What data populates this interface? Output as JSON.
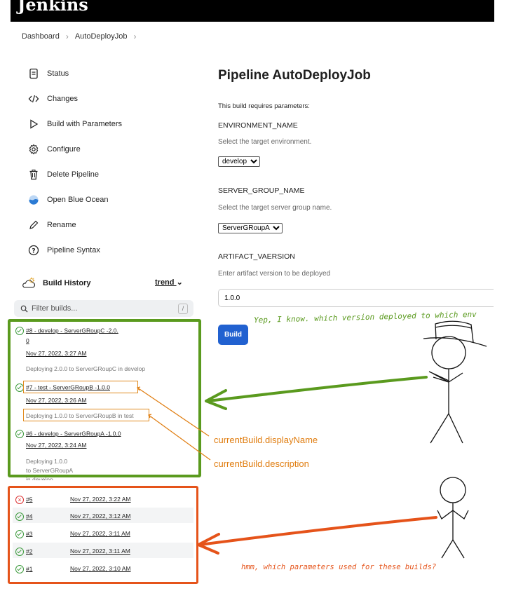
{
  "header": {
    "logo_text": "Jenkins"
  },
  "breadcrumb": {
    "items": [
      "Dashboard",
      "AutoDeployJob"
    ]
  },
  "sidebar": {
    "items": [
      {
        "label": "Status",
        "icon": "document-icon"
      },
      {
        "label": "Changes",
        "icon": "code-icon"
      },
      {
        "label": "Build with Parameters",
        "icon": "play-icon"
      },
      {
        "label": "Configure",
        "icon": "gear-icon"
      },
      {
        "label": "Delete Pipeline",
        "icon": "trash-icon"
      },
      {
        "label": "Open Blue Ocean",
        "icon": "blue-ocean-icon"
      },
      {
        "label": "Rename",
        "icon": "pencil-icon"
      },
      {
        "label": "Pipeline Syntax",
        "icon": "help-icon"
      }
    ]
  },
  "build_history": {
    "title": "Build History",
    "trend_label": "trend",
    "filter_placeholder": "Filter builds...",
    "filter_shortcut": "/",
    "detailed_builds": [
      {
        "name": "#8 - develop - ServerGRoupC -2.0.",
        "name_cont": "0",
        "date": "Nov 27, 2022, 3:27 AM",
        "desc": "Deploying 2.0.0 to ServerGRoupC in develop",
        "status": "success"
      },
      {
        "name": "#7 - test - ServerGRoupB -1.0.0",
        "date": "Nov 27, 2022, 3:26 AM",
        "desc": "Deploying 1.0.0 to ServerGRoupB in test",
        "status": "success"
      },
      {
        "name": "#6 - develop - ServerGRoupA -1.0.0",
        "date": "Nov 27, 2022, 3:24 AM",
        "desc_lines": [
          "Deploying 1.0.0",
          "to ServerGRoupA",
          "in develop"
        ],
        "status": "success"
      }
    ],
    "plain_builds": [
      {
        "name": "#5",
        "date": "Nov 27, 2022, 3:22 AM",
        "status": "failed"
      },
      {
        "name": "#4",
        "date": "Nov 27, 2022, 3:12 AM",
        "status": "success"
      },
      {
        "name": "#3",
        "date": "Nov 27, 2022, 3:11 AM",
        "status": "success"
      },
      {
        "name": "#2",
        "date": "Nov 27, 2022, 3:11 AM",
        "status": "success"
      },
      {
        "name": "#1",
        "date": "Nov 27, 2022, 3:10 AM",
        "status": "success"
      }
    ]
  },
  "main": {
    "title": "Pipeline AutoDeployJob",
    "intro": "This build requires parameters:",
    "params": [
      {
        "name": "ENVIRONMENT_NAME",
        "hint": "Select the target environment.",
        "value": "develop"
      },
      {
        "name": "SERVER_GROUP_NAME",
        "hint": "Select the target server group name.",
        "value": "ServerGRoupA"
      },
      {
        "name": "ARTIFACT_VAERSION",
        "hint": "Enter artifact version to be deployed",
        "value": "1.0.0"
      }
    ],
    "build_button": "Build"
  },
  "annotations": {
    "display_name": "currentBuild.displayName",
    "description": "currentBuild.description",
    "comment_top": "Yep, I know. which version deployed to which env",
    "comment_bottom": "hmm, which parameters used for these builds?",
    "colors": {
      "green": "#5a9a1e",
      "red": "#e5531a",
      "orange": "#e07d10"
    }
  }
}
